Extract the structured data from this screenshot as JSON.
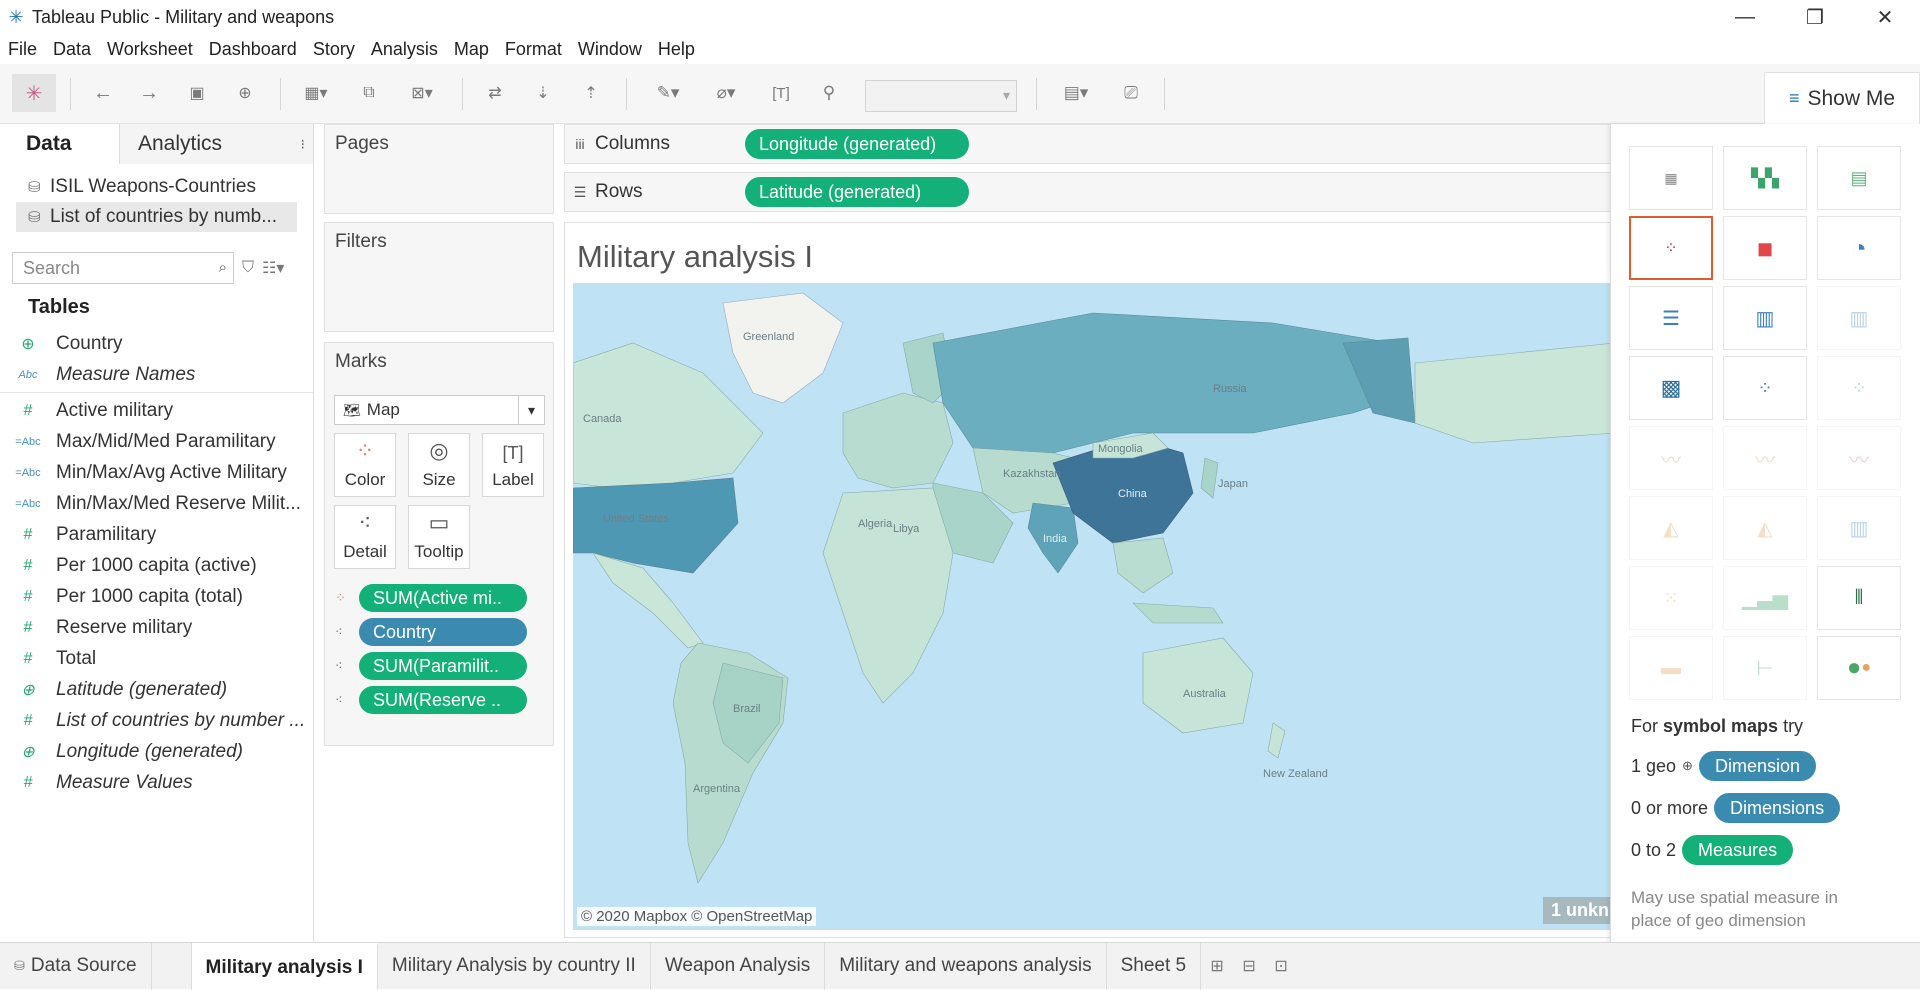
{
  "window": {
    "title": "Tableau Public - Military and weapons",
    "controls": [
      "—",
      "❐",
      "✕"
    ]
  },
  "menu": [
    "File",
    "Data",
    "Worksheet",
    "Dashboard",
    "Story",
    "Analysis",
    "Map",
    "Format",
    "Window",
    "Help"
  ],
  "toolbar": {
    "show_me_label": "Show Me"
  },
  "data_pane": {
    "tabs": {
      "data": "Data",
      "analytics": "Analytics"
    },
    "data_sources": [
      "ISIL Weapons-Countries",
      "List of countries by numb..."
    ],
    "search_placeholder": "Search",
    "tables_title": "Tables",
    "dimensions": [
      {
        "label": "Country",
        "icon": "globe-icon",
        "italic": false
      },
      {
        "label": "Measure Names",
        "icon": "abc-icon",
        "italic": true
      }
    ],
    "measures": [
      {
        "label": "Active military",
        "icon": "hash-icon",
        "italic": false
      },
      {
        "label": "Max/Mid/Med Paramilitary",
        "icon": "abc-icon",
        "italic": false
      },
      {
        "label": "Min/Max/Avg Active Military",
        "icon": "abc-icon",
        "italic": false
      },
      {
        "label": "Min/Max/Med Reserve Milit...",
        "icon": "abc-icon",
        "italic": false
      },
      {
        "label": "Paramilitary",
        "icon": "hash-icon",
        "italic": false
      },
      {
        "label": "Per 1000 capita (active)",
        "icon": "hash-icon",
        "italic": false
      },
      {
        "label": "Per 1000 capita (total)",
        "icon": "hash-icon",
        "italic": false
      },
      {
        "label": "Reserve military",
        "icon": "hash-icon",
        "italic": false
      },
      {
        "label": "Total",
        "icon": "hash-icon",
        "italic": false
      },
      {
        "label": "Latitude (generated)",
        "icon": "globe-icon",
        "italic": true
      },
      {
        "label": "List of countries by number ...",
        "icon": "hash-icon",
        "italic": true
      },
      {
        "label": "Longitude (generated)",
        "icon": "globe-icon",
        "italic": true
      },
      {
        "label": "Measure Values",
        "icon": "hash-icon",
        "italic": true
      }
    ]
  },
  "cards": {
    "pages": "Pages",
    "filters": "Filters",
    "marks": {
      "title": "Marks",
      "type": "Map",
      "buttons": [
        "Color",
        "Size",
        "Label",
        "Detail",
        "Tooltip"
      ],
      "pills": [
        {
          "label": "SUM(Active mi..",
          "kind": "green",
          "icon": "color-dots-icon"
        },
        {
          "label": "Country",
          "kind": "blue",
          "icon": "detail-icon"
        },
        {
          "label": "SUM(Paramilit..",
          "kind": "green",
          "icon": "detail-icon"
        },
        {
          "label": "SUM(Reserve ..",
          "kind": "green",
          "icon": "detail-icon"
        }
      ]
    }
  },
  "shelves": {
    "columns": {
      "label": "Columns",
      "pill": "Longitude (generated)"
    },
    "rows": {
      "label": "Rows",
      "pill": "Latitude (generated)"
    }
  },
  "viz": {
    "title": "Military analysis I",
    "attribution": "© 2020 Mapbox © OpenStreetMap",
    "unknown_badge": "1 unkn",
    "map_labels": [
      "Greenland",
      "Russia",
      "United States",
      "Canada",
      "China",
      "India",
      "Brazil",
      "Australia",
      "New Zealand",
      "Kazakhstan",
      "Mongolia",
      "Algeria",
      "Libya",
      "Argentina",
      "Japan"
    ],
    "colors": {
      "ocean": "#bfe3f4",
      "low": "#c8e6d8",
      "mid": "#7fb8c4",
      "high": "#4a8fae",
      "highest": "#3a6f95"
    }
  },
  "show_me": {
    "hint_prefix": "For ",
    "hint_bold": "symbol maps",
    "hint_suffix": " try",
    "rows": [
      {
        "label": "1 geo",
        "pill": "Dimension",
        "kind": "blue"
      },
      {
        "label": "0 or more",
        "pill": "Dimensions",
        "kind": "blue"
      },
      {
        "label": "0 to 2",
        "pill": "Measures",
        "kind": "green"
      }
    ],
    "note": "May use spatial measure in place of geo dimension"
  },
  "tabs": [
    {
      "label": "Data Source",
      "active": false
    },
    {
      "label": "Military analysis I",
      "active": true
    },
    {
      "label": "Military Analysis by country II",
      "active": false
    },
    {
      "label": "Weapon Analysis",
      "active": false
    },
    {
      "label": "Military and weapons analysis",
      "active": false
    },
    {
      "label": "Sheet 5",
      "active": false
    }
  ]
}
